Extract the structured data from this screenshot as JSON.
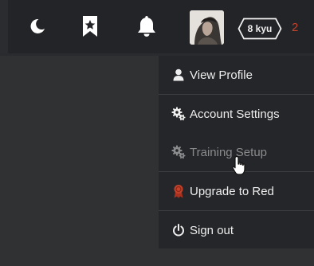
{
  "header": {
    "theme_toggle_icon": "moon-icon",
    "bookmarks_icon": "bookmark-star-icon",
    "notifications_icon": "bell-icon",
    "avatar": "user-avatar",
    "rank": {
      "label": "8 kyu",
      "color": "#ffffff"
    },
    "honor": "2"
  },
  "menu": {
    "items": [
      {
        "label": "View Profile",
        "icon": "user-icon"
      },
      {
        "label": "Account Settings",
        "icon": "gear-icon"
      },
      {
        "label": "Training Setup",
        "icon": "gear-icon"
      },
      {
        "label": "Upgrade to Red",
        "icon": "red-ribbon-icon"
      },
      {
        "label": "Sign out",
        "icon": "power-icon"
      }
    ]
  },
  "colors": {
    "topbar_bg": "#232427",
    "page_bg": "#303133",
    "menu_bg": "#252629",
    "accent_red": "#c2422c"
  }
}
